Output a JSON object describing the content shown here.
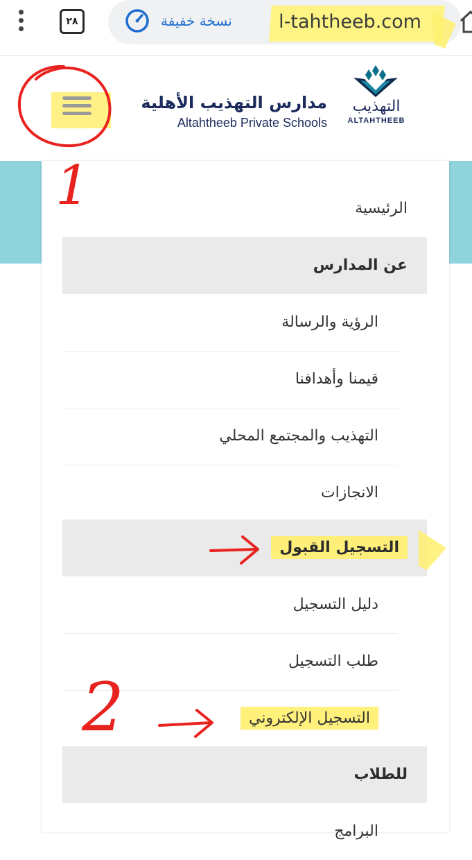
{
  "browser": {
    "tab_count": "٢٨",
    "lite_mode_label": "نسخة خفيفة",
    "url": "l-tahtheeb.com"
  },
  "site": {
    "name_ar": "مدارس التهذيب الأهلية",
    "name_en": "Altahtheeb Private Schools",
    "logo_ar": "التهذيب",
    "logo_en": "ALTAHTHEEB"
  },
  "menu": {
    "home": "الرئيسية",
    "about": "عن المدارس",
    "about_items": [
      "الرؤية والرسالة",
      "قيمنا وأهدافنا",
      "التهذيب والمجتمع المحلي",
      "الانجازات"
    ],
    "admission": "التسجيل القبول",
    "admission_items": [
      "دليل التسجيل",
      "طلب التسجيل",
      "التسجيل الإلكتروني"
    ],
    "students": "للطلاب",
    "students_items": [
      "البرامج"
    ]
  },
  "annotations": {
    "step1": "1",
    "step2": "2"
  },
  "colors": {
    "accent_teal": "#8fd3dd",
    "brand_navy": "#1b2a5c",
    "highlight_yellow": "#fff06e",
    "annotation_red": "#e8231f"
  }
}
